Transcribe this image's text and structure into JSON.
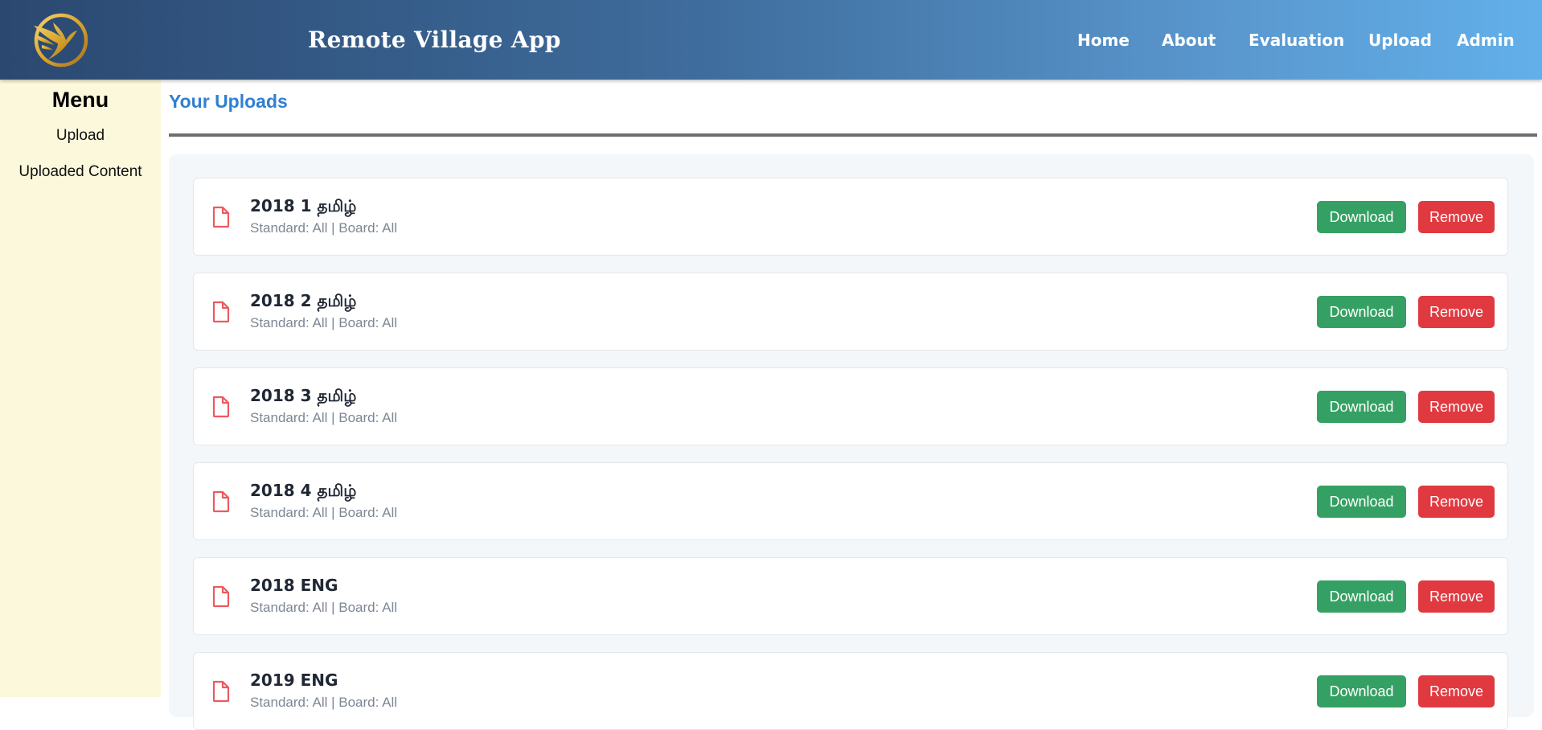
{
  "header": {
    "app_title": "Remote Village App",
    "nav": [
      "Home",
      "About",
      "Evaluation",
      "Upload",
      "Admin"
    ]
  },
  "sidebar": {
    "title": "Menu",
    "items": [
      "Upload",
      "Uploaded Content"
    ]
  },
  "main": {
    "page_title": "Your Uploads",
    "uploads": [
      {
        "title": "2018 1 தமிழ்",
        "meta": "Standard: All | Board: All"
      },
      {
        "title": "2018 2 தமிழ்",
        "meta": "Standard: All | Board: All"
      },
      {
        "title": "2018 3 தமிழ்",
        "meta": "Standard: All | Board: All"
      },
      {
        "title": "2018 4 தமிழ்",
        "meta": "Standard: All | Board: All"
      },
      {
        "title": "2018 ENG",
        "meta": "Standard: All | Board: All"
      },
      {
        "title": "2019 ENG",
        "meta": "Standard: All | Board: All"
      }
    ],
    "download_label": "Download",
    "remove_label": "Remove"
  },
  "colors": {
    "download": "#35a063",
    "remove": "#e0393f",
    "accent": "#2f80d0",
    "sidebar_bg": "#fcf8dc",
    "file_icon": "#ec5a5f"
  },
  "icons": {
    "logo": "bird-logo-icon",
    "file": "file-icon"
  }
}
